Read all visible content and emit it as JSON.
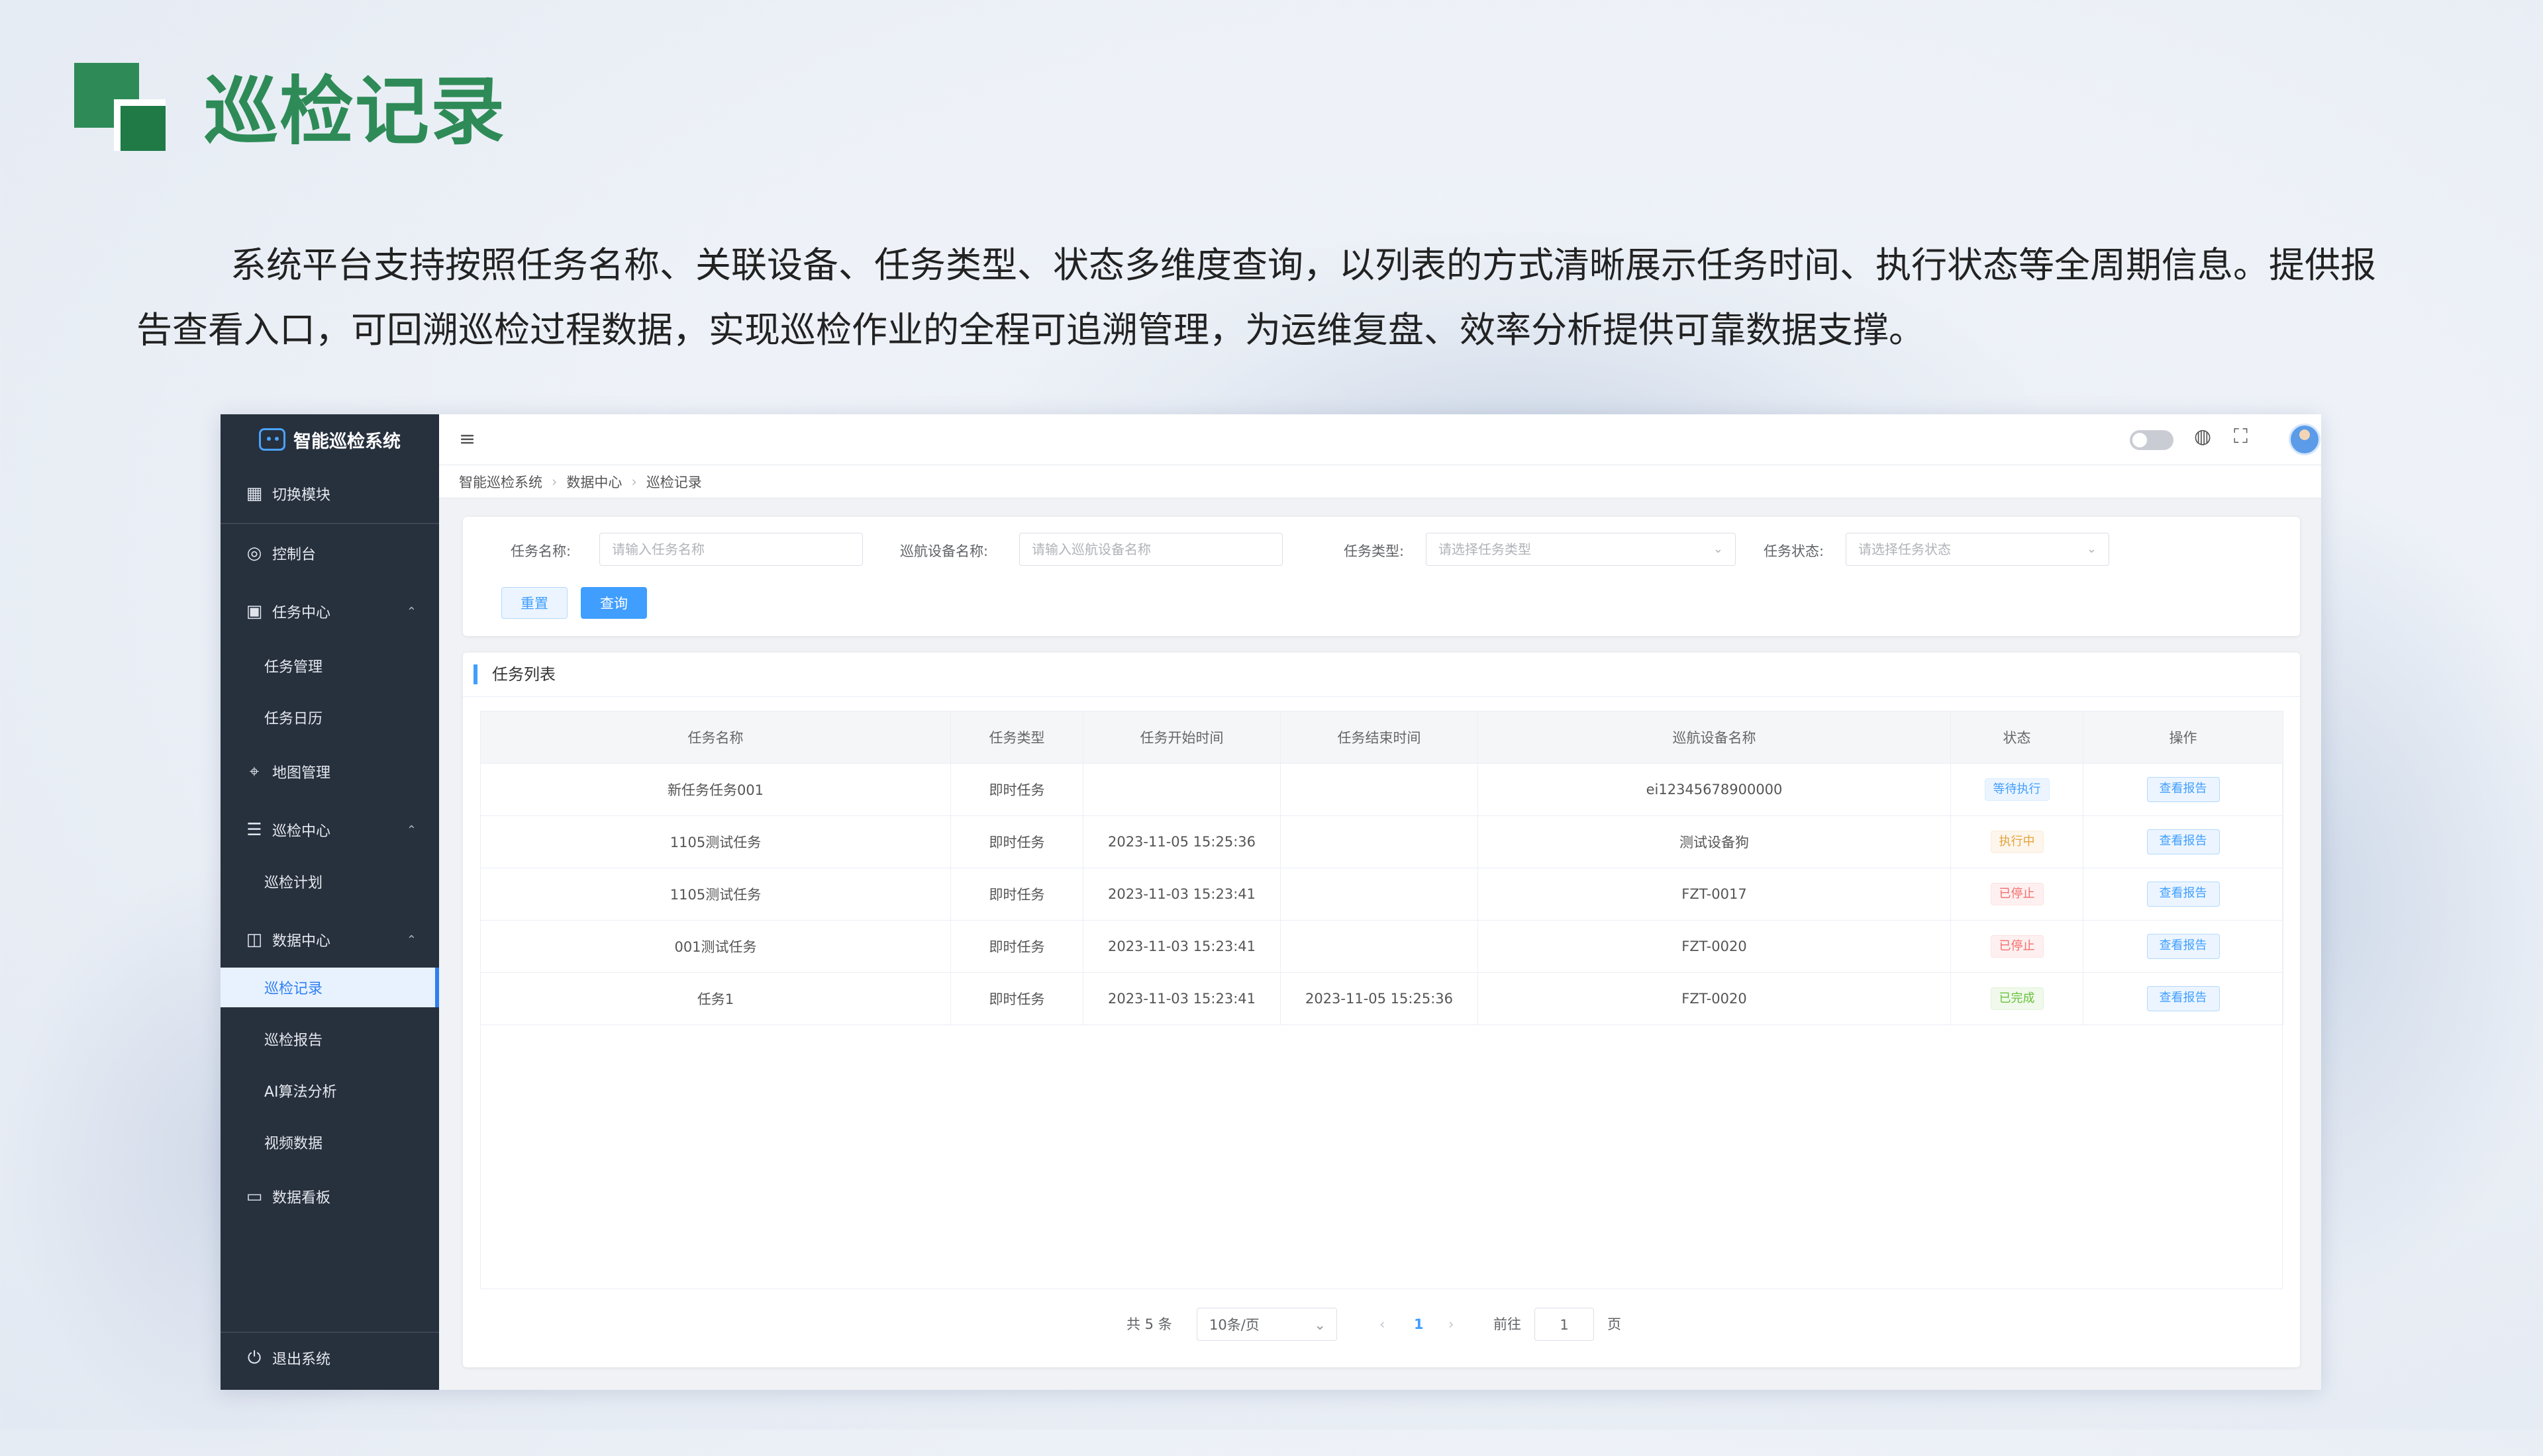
{
  "slide": {
    "title": "巡检记录",
    "description": "系统平台支持按照任务名称、关联设备、任务类型、状态多维度查询，以列表的方式清晰展示任务时间、执行状态等全周期信息。提供报告查看入口，可回溯巡检过程数据，实现巡检作业的全程可追溯管理，为运维复盘、效率分析提供可靠数据支撑。"
  },
  "colors": {
    "brand_green": "#2e8b57",
    "sidebar_bg": "#27303d",
    "accent": "#409eff"
  },
  "sidebar": {
    "brand": "智能巡检系统",
    "switch_module": "切换模块",
    "items": {
      "dashboard": "控制台",
      "task_center": "任务中心",
      "task_manage": "任务管理",
      "task_calendar": "任务日历",
      "map_manage": "地图管理",
      "patrol_center": "巡检中心",
      "patrol_plan": "巡检计划",
      "data_center": "数据中心",
      "patrol_record": "巡检记录",
      "patrol_report": "巡检报告",
      "ai_analysis": "AI算法分析",
      "video_data": "视频数据",
      "data_board": "数据看板"
    },
    "logout": "退出系统"
  },
  "breadcrumb": [
    "智能巡检系统",
    "数据中心",
    "巡检记录"
  ],
  "search": {
    "task_name_label": "任务名称:",
    "task_name_placeholder": "请输入任务名称",
    "device_label": "巡航设备名称:",
    "device_placeholder": "请输入巡航设备名称",
    "type_label": "任务类型:",
    "type_placeholder": "请选择任务类型",
    "status_label": "任务状态:",
    "status_placeholder": "请选择任务状态",
    "reset": "重置",
    "query": "查询"
  },
  "list": {
    "title": "任务列表",
    "columns": [
      "任务名称",
      "任务类型",
      "任务开始时间",
      "任务结束时间",
      "巡航设备名称",
      "状态",
      "操作"
    ],
    "rows": [
      {
        "name": "新任务任务001",
        "type": "即时任务",
        "start": "",
        "end": "",
        "device": "ei12345678900000",
        "status": "等待执行",
        "action": "查看报告"
      },
      {
        "name": "1105测试任务",
        "type": "即时任务",
        "start": "2023-11-05 15:25:36",
        "end": "",
        "device": "测试设备狗",
        "status": "执行中",
        "action": "查看报告"
      },
      {
        "name": "1105测试任务",
        "type": "即时任务",
        "start": "2023-11-03 15:23:41",
        "end": "",
        "device": "FZT-0017",
        "status": "已停止",
        "action": "查看报告"
      },
      {
        "name": "001测试任务",
        "type": "即时任务",
        "start": "2023-11-03 15:23:41",
        "end": "",
        "device": "FZT-0020",
        "status": "已停止",
        "action": "查看报告"
      },
      {
        "name": "任务1",
        "type": "即时任务",
        "start": "2023-11-03 15:23:41",
        "end": "2023-11-05 15:25:36",
        "device": "FZT-0020",
        "status": "已完成",
        "action": "查看报告"
      }
    ]
  },
  "pagination": {
    "total": "共 5 条",
    "page_size": "10条/页",
    "prev": "‹",
    "current": "1",
    "next": "›",
    "goto_label": "前往",
    "goto_value": "1",
    "page_unit": "页"
  }
}
